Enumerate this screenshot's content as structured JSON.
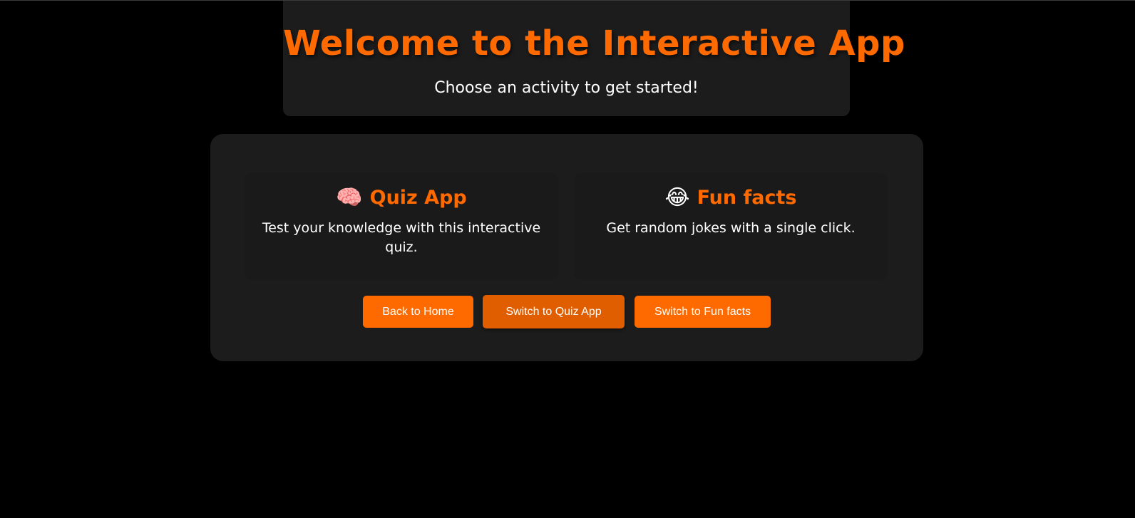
{
  "header": {
    "title": "Welcome to the Interactive App",
    "subtitle": "Choose an activity to get started!"
  },
  "activities": [
    {
      "emoji": "🧠",
      "icon": "brain-icon",
      "title": "Quiz App",
      "description": "Test your knowledge with this interactive quiz."
    },
    {
      "emoji": "😂",
      "icon": "laughing-face-icon",
      "title": "Fun facts",
      "description": "Get random jokes with a single click."
    }
  ],
  "buttons": {
    "home_label": "Back to Home",
    "quiz_label": "Switch to Quiz App",
    "facts_label": "Switch to Fun facts"
  },
  "colors": {
    "accent": "#ff6a00",
    "background": "#000000",
    "card": "#1c1c1c",
    "text": "#ffffff"
  }
}
